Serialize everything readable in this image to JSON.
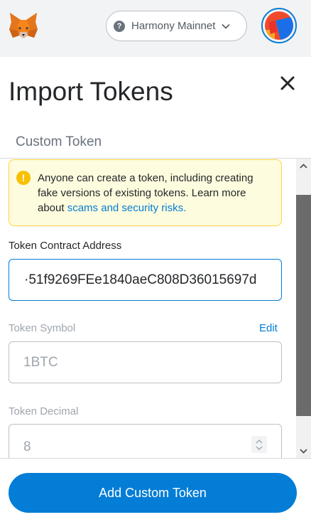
{
  "header": {
    "network_label": "Harmony Mainnet",
    "network_help_glyph": "?"
  },
  "page": {
    "title": "Import Tokens",
    "tab_label": "Custom Token"
  },
  "warning": {
    "icon_glyph": "!",
    "text": "Anyone can create a token, including creating fake versions of existing tokens. Learn more about ",
    "link_text": "scams and security risks."
  },
  "form": {
    "contract_label": "Token Contract Address",
    "contract_value": "·51f9269FEe1840aeC808D36015697d",
    "symbol_label": "Token Symbol",
    "symbol_edit": "Edit",
    "symbol_value": "1BTC",
    "decimal_label": "Token Decimal",
    "decimal_value": "8"
  },
  "footer": {
    "add_button_label": "Add Custom Token"
  },
  "colors": {
    "accent": "#037dd6",
    "warning_bg": "#fefcde",
    "warning_border": "#ffd33d",
    "topbar_bg": "#f2f3f4"
  },
  "icons": [
    "metamask-fox-icon",
    "help-icon",
    "chevron-down-icon",
    "account-avatar",
    "close-icon",
    "warning-icon",
    "stepper-icon",
    "scroll-up-arrow-icon",
    "scroll-down-arrow-icon"
  ]
}
